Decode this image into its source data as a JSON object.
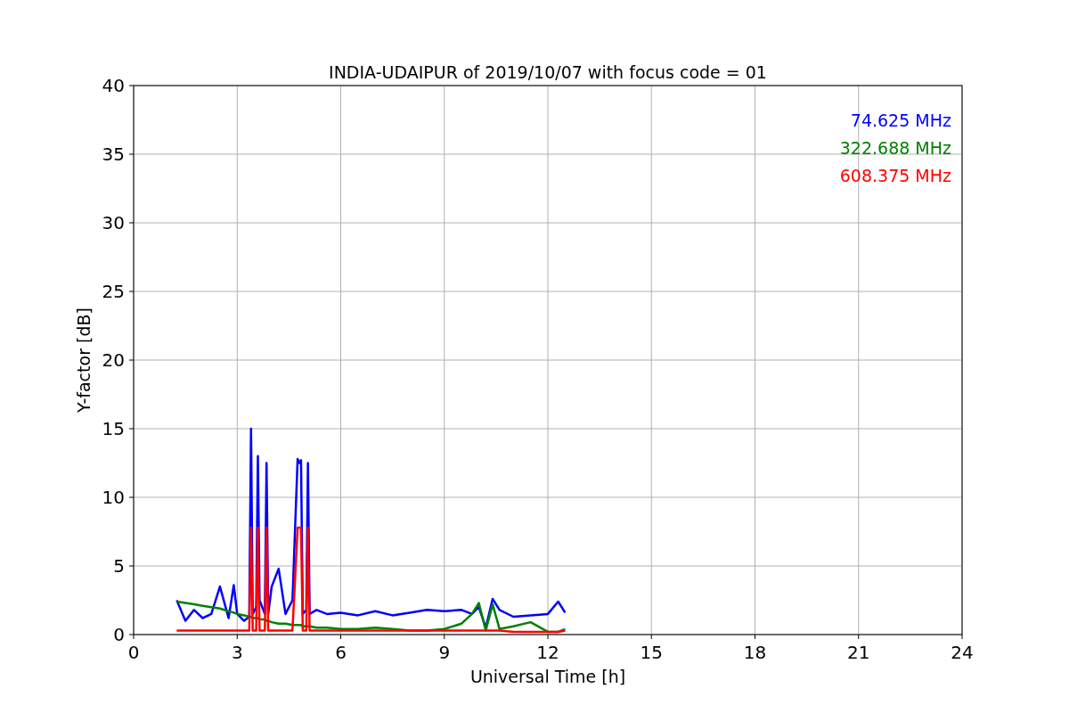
{
  "chart_data": {
    "type": "line",
    "title": "INDIA-UDAIPUR of 2019/10/07 with focus code = 01",
    "xlabel": "Universal Time [h]",
    "ylabel": "Y-factor [dB]",
    "x": [
      1.25,
      1.5,
      1.75,
      2.0,
      2.25,
      2.5,
      2.75,
      2.9,
      3.0,
      3.2,
      3.35,
      3.4,
      3.45,
      3.55,
      3.6,
      3.65,
      3.8,
      3.85,
      3.9,
      4.0,
      4.2,
      4.4,
      4.6,
      4.75,
      4.8,
      4.85,
      4.9,
      5.0,
      5.05,
      5.1,
      5.3,
      5.6,
      6.0,
      6.5,
      7.0,
      7.5,
      8.0,
      8.5,
      9.0,
      9.5,
      9.8,
      10.0,
      10.2,
      10.4,
      10.6,
      11.0,
      11.5,
      12.0,
      12.3,
      12.5
    ],
    "series": [
      {
        "name": "74.625 MHz",
        "color": "#0000ff",
        "values": [
          2.5,
          1.0,
          1.8,
          1.2,
          1.5,
          3.5,
          1.2,
          3.6,
          1.5,
          1.0,
          1.3,
          15,
          1.5,
          2.0,
          13,
          2.5,
          1.5,
          12.5,
          1.5,
          3.5,
          4.8,
          1.5,
          2.5,
          12.8,
          12.5,
          12.7,
          1.5,
          1.8,
          12.5,
          1.5,
          1.8,
          1.5,
          1.6,
          1.4,
          1.7,
          1.4,
          1.6,
          1.8,
          1.7,
          1.8,
          1.5,
          2.0,
          0.5,
          2.6,
          1.8,
          1.3,
          1.4,
          1.5,
          2.4,
          1.6
        ]
      },
      {
        "name": "322.688 MHz",
        "color": "#008000",
        "values": [
          2.4,
          2.3,
          2.2,
          2.1,
          2.0,
          1.9,
          1.7,
          1.6,
          1.5,
          1.4,
          1.3,
          1.3,
          1.2,
          1.2,
          1.2,
          1.1,
          1.1,
          1.0,
          1.0,
          0.9,
          0.8,
          0.8,
          0.7,
          0.7,
          0.7,
          0.7,
          0.6,
          0.6,
          0.6,
          0.6,
          0.5,
          0.5,
          0.4,
          0.4,
          0.5,
          0.4,
          0.3,
          0.3,
          0.4,
          0.8,
          1.5,
          2.3,
          0.3,
          2.2,
          0.4,
          0.6,
          0.9,
          0.2,
          0.2,
          0.4
        ]
      },
      {
        "name": "608.375 MHz",
        "color": "#ff0000",
        "values": [
          0.3,
          0.3,
          0.3,
          0.3,
          0.3,
          0.3,
          0.3,
          0.3,
          0.3,
          0.3,
          0.3,
          7.8,
          0.3,
          0.3,
          7.8,
          0.3,
          0.3,
          7.8,
          0.3,
          0.3,
          0.3,
          0.3,
          0.3,
          7.8,
          7.8,
          7.8,
          0.3,
          0.3,
          7.8,
          0.3,
          0.3,
          0.3,
          0.3,
          0.3,
          0.3,
          0.3,
          0.3,
          0.3,
          0.3,
          0.3,
          0.3,
          0.3,
          0.3,
          0.3,
          0.3,
          0.2,
          0.2,
          0.2,
          0.2,
          0.3
        ]
      }
    ],
    "xlim": [
      0,
      24
    ],
    "ylim": [
      0,
      40
    ],
    "xticks": [
      0,
      3,
      6,
      9,
      12,
      15,
      18,
      21,
      24
    ],
    "yticks": [
      0,
      5,
      10,
      15,
      20,
      25,
      30,
      35,
      40
    ],
    "grid": true
  }
}
